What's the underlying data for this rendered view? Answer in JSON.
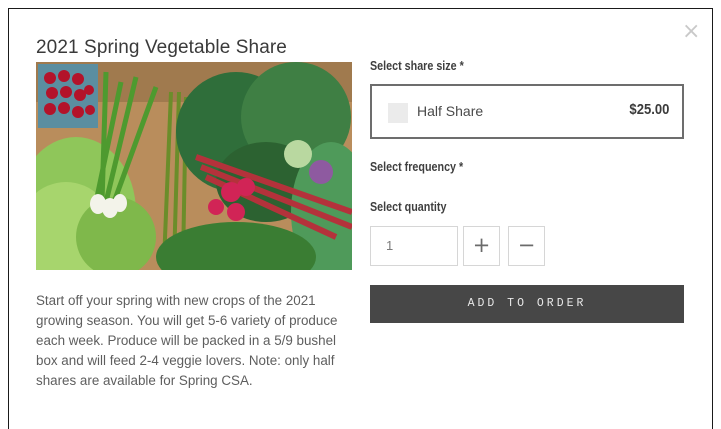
{
  "modal": {
    "title": "2021 Spring Vegetable Share",
    "close_icon": "close-icon",
    "description": "Start off your spring with new crops of the 2021 growing season. You will get 5-6 variety of produce each week. Produce will be packed in a 5/9 bushel box and will feed 2-4 veggie lovers. Note: only half shares are available for Spring CSA."
  },
  "options": {
    "share_size_label": "Select share size *",
    "share_option": {
      "name": "Half Share",
      "price": "$25.00",
      "checked": false
    },
    "frequency_label": "Select frequency *",
    "quantity_label": "Select quantity",
    "quantity_value": "1",
    "plus_symbol": "+",
    "minus_symbol": "−"
  },
  "actions": {
    "add_to_order_label": "ADD TO ORDER"
  },
  "colors": {
    "button_bg": "#474747",
    "border": "#6d6d6d",
    "text": "#3a3a3a"
  }
}
